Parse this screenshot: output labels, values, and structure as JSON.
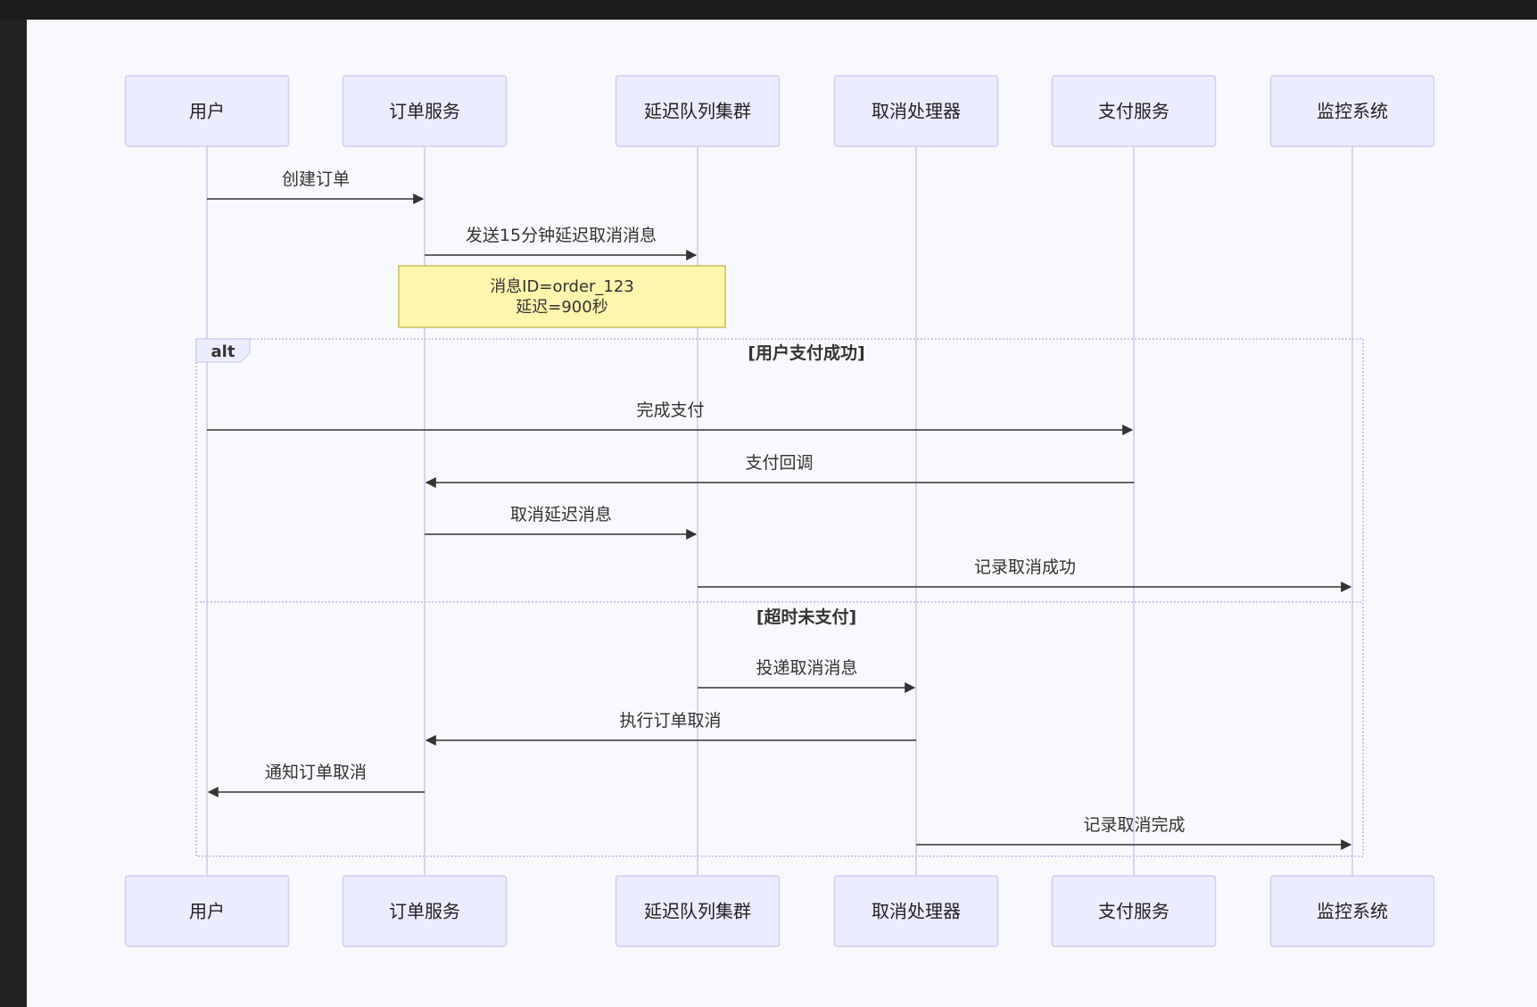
{
  "participants": [
    {
      "id": "user",
      "label": "用户"
    },
    {
      "id": "order",
      "label": "订单服务"
    },
    {
      "id": "delayq",
      "label": "延迟队列集群"
    },
    {
      "id": "cancel",
      "label": "取消处理器"
    },
    {
      "id": "pay",
      "label": "支付服务"
    },
    {
      "id": "monitor",
      "label": "监控系统"
    }
  ],
  "messages": [
    {
      "from": "user",
      "to": "order",
      "label": "创建订单"
    },
    {
      "from": "order",
      "to": "delayq",
      "label": "发送15分钟延迟取消消息"
    },
    {
      "from": "user",
      "to": "pay",
      "label": "完成支付"
    },
    {
      "from": "pay",
      "to": "order",
      "label": "支付回调"
    },
    {
      "from": "order",
      "to": "delayq",
      "label": "取消延迟消息"
    },
    {
      "from": "delayq",
      "to": "monitor",
      "label": "记录取消成功"
    },
    {
      "from": "delayq",
      "to": "cancel",
      "label": "投递取消消息"
    },
    {
      "from": "cancel",
      "to": "order",
      "label": "执行订单取消"
    },
    {
      "from": "order",
      "to": "user",
      "label": "通知订单取消"
    },
    {
      "from": "cancel",
      "to": "monitor",
      "label": "记录取消完成"
    }
  ],
  "note": {
    "lines": [
      "消息ID=order_123",
      "延迟=900秒"
    ]
  },
  "alt": {
    "keyword": "alt",
    "branches": [
      "[用户支付成功]",
      "[超时未支付]"
    ]
  },
  "colors": {
    "actor_fill": "#ececff",
    "actor_stroke": "#d2ccee",
    "lifeline": "#dcd2f0",
    "arrow": "#333333",
    "note_fill": "#fff5ad",
    "note_stroke": "#c8c05a",
    "alt_stroke": "#c9c6ee",
    "text": "#333333"
  }
}
